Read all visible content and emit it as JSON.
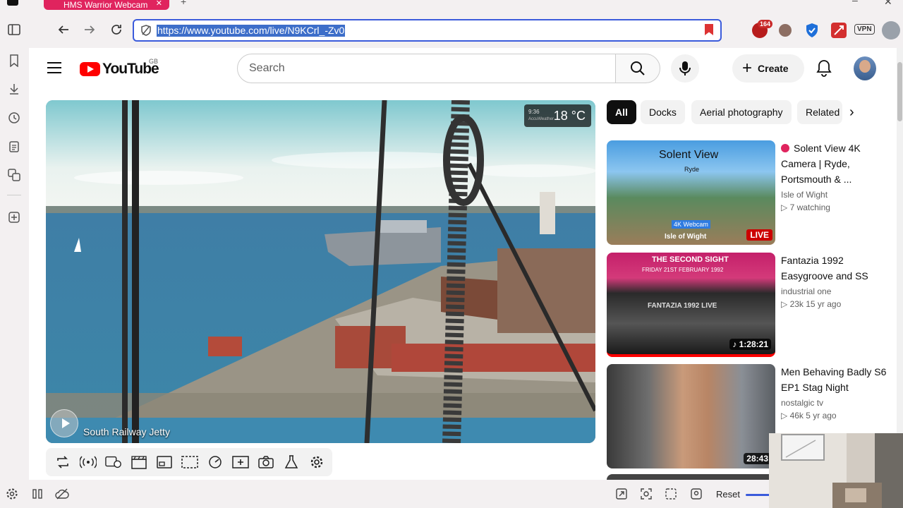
{
  "browser": {
    "tab_title": "HMS Warrior Webcam",
    "url": "https://www.youtube.com/live/N9KCrl_-Zv0",
    "extension_badge": "164",
    "vpn_label": "VPN"
  },
  "youtube": {
    "logo_text": "YouTube",
    "region": "GB",
    "search_placeholder": "Search",
    "create_label": "Create"
  },
  "video": {
    "weather_time": "9:36",
    "weather_brand": "AccuWeather",
    "temperature": "18 °C",
    "camera_label": "South Railway Jetty"
  },
  "chips": [
    "All",
    "Docks",
    "Aerial photography",
    "Related"
  ],
  "recommendations": [
    {
      "title": "Solent View 4K Camera | Ryde, Portsmouth & ...",
      "channel": "Isle of Wight",
      "stats": "▷ 7 watching",
      "badge": "LIVE",
      "is_live": true,
      "thumb_title": "Solent View",
      "thumb_subtitle": "Ryde",
      "thumb_tag": "4K Webcam",
      "thumb_brand": "Isle of Wight"
    },
    {
      "title": "Fantazia 1992 Easygroove and SS",
      "channel": "industrial one",
      "stats": "▷ 23k  15 yr ago",
      "badge": "♪ 1:28:21",
      "is_live": false,
      "thumb_title": "THE SECOND SIGHT",
      "thumb_subtitle": "FRIDAY 21ST FEBRUARY 1992",
      "thumb_tag": "FANTAZIA 1992 LIVE"
    },
    {
      "title": "Men Behaving Badly S6 EP1  Stag Night",
      "channel": "nostalgic tv",
      "stats": "▷ 46k  5 yr ago",
      "badge": "28:43",
      "is_live": false
    }
  ],
  "bottom_bar": {
    "reset_label": "Reset"
  },
  "colors": {
    "youtube_red": "#ff0000",
    "url_border": "#3b5bdb",
    "url_highlight": "#3d6ec9",
    "tab_accent": "#e0245e"
  }
}
